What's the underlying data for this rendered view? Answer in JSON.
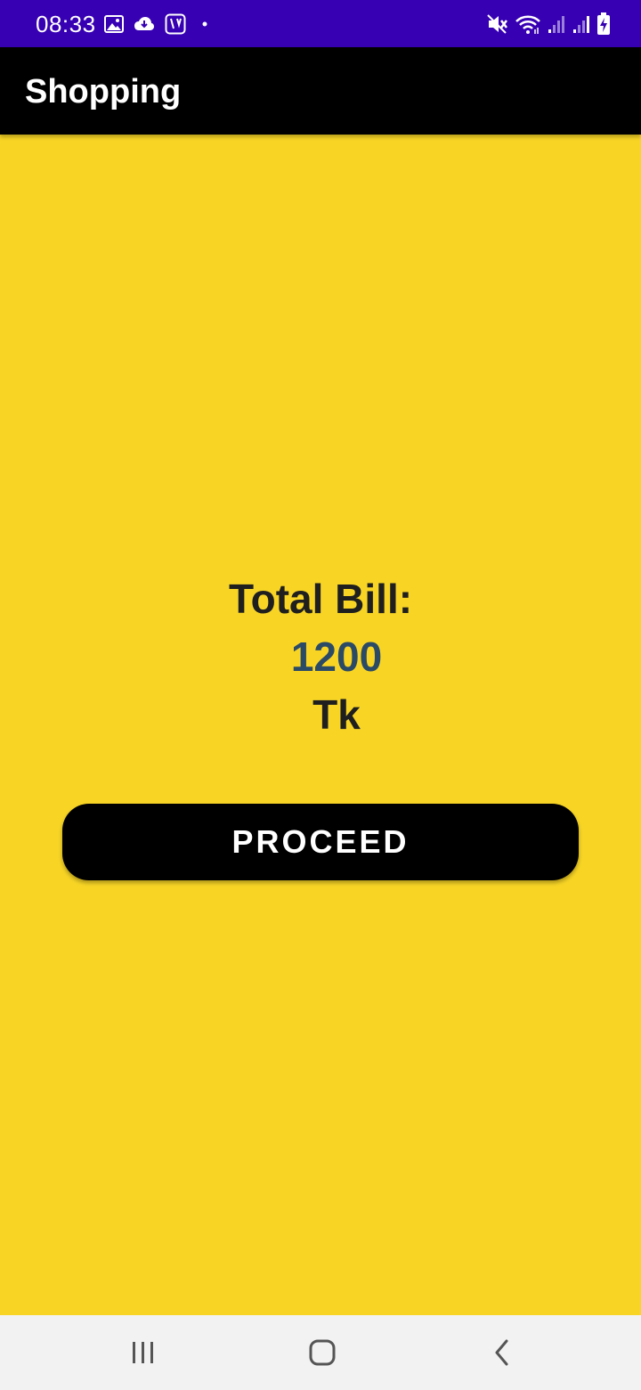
{
  "status_bar": {
    "time": "08:33",
    "left_icons": [
      "image-icon",
      "cloud-download-icon",
      "app-notification-icon",
      "dot-icon"
    ],
    "right_icons": [
      "mute-icon",
      "wifi-icon",
      "signal-icon",
      "signal-icon",
      "battery-charging-icon"
    ],
    "background_color": "#3700b3"
  },
  "app_bar": {
    "title": "Shopping",
    "background_color": "#000000"
  },
  "content": {
    "background_color": "#f8d525",
    "total_label": "Total Bill:",
    "total_amount": "1200",
    "currency": "Tk",
    "amount_color": "#2b4a66",
    "proceed_label": "PROCEED"
  },
  "nav_bar": {
    "buttons": [
      "recents-icon",
      "home-icon",
      "back-icon"
    ]
  }
}
